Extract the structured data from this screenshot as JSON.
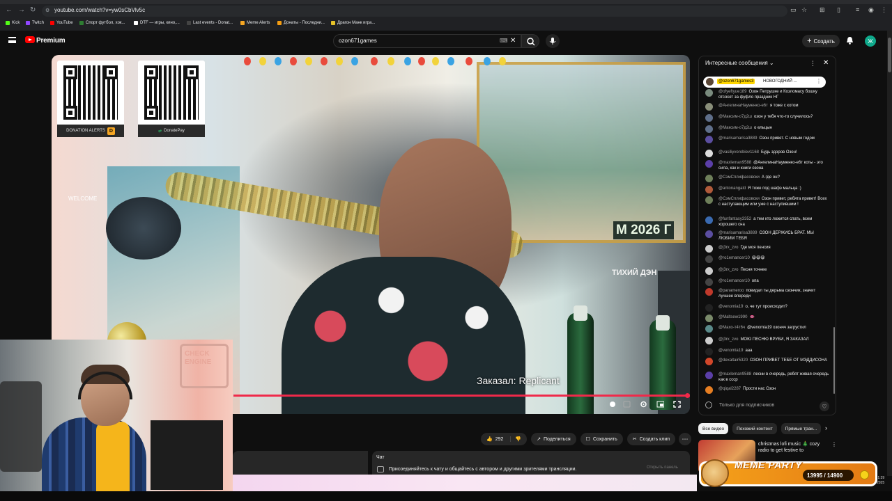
{
  "browser": {
    "url": "youtube.com/watch?v=yw0sCbVlv5c",
    "bookmarks": [
      "Kick",
      "Twitch",
      "YouTube",
      "Спорт футбол, хок...",
      "DTF — игры, кино,...",
      "Last events - Donat...",
      "Meme Alerts",
      "Донаты - Последни...",
      "Драгон Манк игра..."
    ]
  },
  "header": {
    "brand": "Premium",
    "search_value": "ozon671games",
    "create_label": "Создать",
    "avatar_letter": "Ж"
  },
  "video": {
    "qr1_label": "DONATION ALERTS",
    "qr1_badge": "D",
    "qr2_label": "DonatePay",
    "santa_text": "WELCOME",
    "poster_banner": "М 2026 Г",
    "poster_title": "ТИХИЙ ДЭН",
    "caption": "Заказал: Replicant",
    "progress": 1.0
  },
  "webcam": {
    "wall_logo": "CHECK ENGINE"
  },
  "actions": {
    "likes": "292",
    "share": "Поделиться",
    "save": "Сохранить",
    "clip": "Создать клип"
  },
  "chat_small": {
    "title": "Чат",
    "text": "Присоединяйтесь к чату и общайтесь с автором и другими зрителями трансляции.",
    "button": "Открыть панель"
  },
  "live_chat": {
    "title": "Интересные сообщения",
    "pinned_name": "@ozon671games3",
    "pinned_text": "НОВОГОДНИЙ ...",
    "input_label": "Только для подписчиков",
    "messages": [
      {
        "author": "@ofyeftyue189",
        "text": "Озон Петрушке и Козломасу бошку отсосет за фуфло праздник НГ",
        "color": "#7a8b7e"
      },
      {
        "author": "@АнгелинаНауменко-е6т",
        "text": "я тоже с котом",
        "color": "#8a8f7a"
      },
      {
        "author": "@Максим-о7д2ш",
        "text": "озон у тебя что-то случилось?",
        "color": "#5f6f8a"
      },
      {
        "author": "@Максим-о7д2ш",
        "text": "о ельцын",
        "color": "#5f6f8a"
      },
      {
        "author": "@marisamarisa3889",
        "text": "Озон привет. С новым годом",
        "color": "#5b4ea0"
      },
      {
        "author": "@vasiliyvorobiev1168",
        "text": "Будь здоров Озон!",
        "color": "#dddddd"
      },
      {
        "author": "@maxleman9588",
        "text": "@АнгелинаНауменко-е6т коты - это сила, как и книги озона",
        "color": "#5b3fa8"
      },
      {
        "author": "@СэмСплифасовски",
        "text": "А где он?",
        "color": "#6e7f5a"
      },
      {
        "author": "@antonangald",
        "text": "Я тоже под шафэ мальца :)",
        "color": "#b05a3a"
      },
      {
        "author": "@СэмСплифасовски",
        "text": "Озон привет, ребята привет! Всех с наступающим или уже с наступившим !",
        "color": "#6e7f5a"
      },
      {
        "author": "@funfantasy3352",
        "text": "а тем кто ложится спать, всем хорошего сна",
        "color": "#3a6ab0"
      },
      {
        "author": "@marisamarisa3889",
        "text": "ОЗОН ДЕРЖИСЬ БРАТ. МЫ ЛЮБИМ ТЕБЯ",
        "color": "#5b4ea0"
      },
      {
        "author": "@j3rx_zvo",
        "text": "Где моя пенсия",
        "color": "#cccccc"
      },
      {
        "author": "@ro1emancer10",
        "text": "😆😆😆",
        "color": "#444444"
      },
      {
        "author": "@j3rx_zvo",
        "text": "Песня точнее",
        "color": "#cccccc"
      },
      {
        "author": "@ro1emancer10",
        "text": "опа",
        "color": "#444444"
      },
      {
        "author": "@panameroo",
        "text": "повидал ты дерьма озончик, значит лучшее впереди",
        "color": "#c0392b"
      },
      {
        "author": "@venomia19",
        "text": "о, че тут происходит?",
        "color": "#222222"
      },
      {
        "author": "@Maltsew1990",
        "text": "👄",
        "color": "#7a8a6a"
      },
      {
        "author": "@Махо-т4т6ч",
        "text": "@venomia19 озончч загрустил",
        "color": "#5a8a8a"
      },
      {
        "author": "@j3rx_zvo",
        "text": "МОЮ ПЕСНЮ ВРУБИ, Я ЗАКАЗАЛ",
        "color": "#cccccc"
      },
      {
        "author": "@venomia19",
        "text": "ааа",
        "color": "#222222"
      },
      {
        "author": "@dexaltair5320",
        "text": "ОЗОН ПРИВЕТ ТЕБЕ ОТ МЭДДИСОНА",
        "color": "#d2472a"
      },
      {
        "author": "@maxleman9588",
        "text": "песни в очередь, ребят живая очередь как в ссср",
        "color": "#5b3fa8"
      },
      {
        "author": "@qiqal2287",
        "text": "Прости нас Озон",
        "color": "#e67e22"
      }
    ]
  },
  "recommendations": {
    "chips": [
      "Все видео",
      "Похожий контент",
      "Прямые тран..."
    ],
    "title": "christmas lofi music 🎄 cozy radio to get festive to"
  },
  "meme_party": {
    "title": "MEME PARTY",
    "counter": "13995 / 14900"
  },
  "clock": {
    "time": "1:39",
    "year": "2025"
  }
}
